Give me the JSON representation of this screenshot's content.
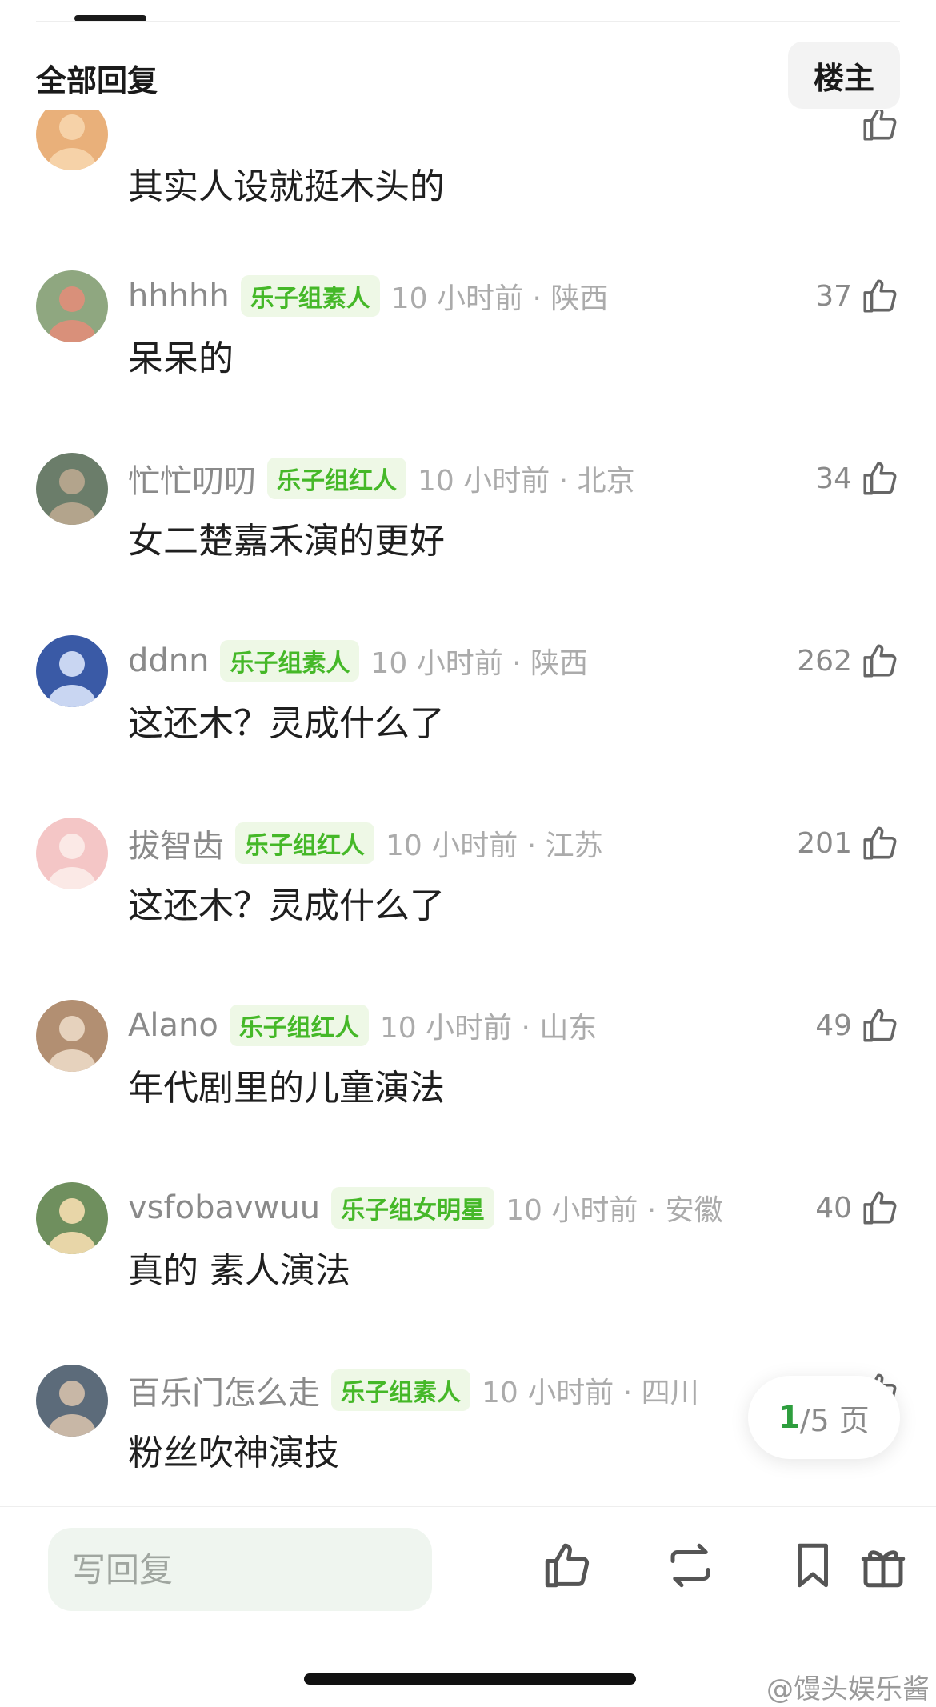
{
  "header": {
    "title": "全部回复",
    "op_button": "楼主"
  },
  "comments": [
    {
      "user": "",
      "tag": "",
      "time": "",
      "likes": "",
      "text": "其实人设就挺木头的",
      "avatar_colors": [
        "#e9b07a",
        "#f6d2a8"
      ]
    },
    {
      "user": "hhhhh",
      "tag": "乐子组素人",
      "time": "10 小时前 · 陕西",
      "likes": "37",
      "text": "呆呆的",
      "avatar_colors": [
        "#8fa780",
        "#d9907a"
      ]
    },
    {
      "user": "忙忙叨叨",
      "tag": "乐子组红人",
      "time": "10 小时前 · 北京",
      "likes": "34",
      "text": "女二楚嘉禾演的更好",
      "avatar_colors": [
        "#6b7d6a",
        "#b3a48c"
      ]
    },
    {
      "user": "ddnn",
      "tag": "乐子组素人",
      "time": "10 小时前 · 陕西",
      "likes": "262",
      "text": "这还木？灵成什么了",
      "avatar_colors": [
        "#3a5aa6",
        "#c9d6f2"
      ]
    },
    {
      "user": "拔智齿",
      "tag": "乐子组红人",
      "time": "10 小时前 · 江苏",
      "likes": "201",
      "text": "这还木？灵成什么了",
      "avatar_colors": [
        "#f4c6c6",
        "#fbe9e6"
      ]
    },
    {
      "user": "Alano",
      "tag": "乐子组红人",
      "time": "10 小时前 · 山东",
      "likes": "49",
      "text": "年代剧里的儿童演法",
      "avatar_colors": [
        "#b28f72",
        "#e6d2bd"
      ]
    },
    {
      "user": "vsfobavwuu",
      "tag": "乐子组女明星",
      "time": "10 小时前 · 安徽",
      "likes": "40",
      "text": "真的 素人演法",
      "avatar_colors": [
        "#6f8f5e",
        "#e8d6a8"
      ]
    },
    {
      "user": "百乐门怎么走",
      "tag": "乐子组素人",
      "time": "10 小时前 · 四川",
      "likes": "",
      "text": "粉丝吹神演技",
      "avatar_colors": [
        "#5c6b7a",
        "#c8b7a6"
      ]
    }
  ],
  "pagination": {
    "current": "1",
    "rest": "/5 页"
  },
  "bottom_bar": {
    "reply_placeholder": "写回复",
    "icons": [
      "like-icon",
      "repost-icon",
      "bookmark-icon",
      "gift-icon"
    ]
  },
  "watermark": "@馒头娱乐酱",
  "colors": {
    "tag_bg": "#eef8e6",
    "tag_text": "#45b828",
    "page_current": "#2e9e3e"
  }
}
